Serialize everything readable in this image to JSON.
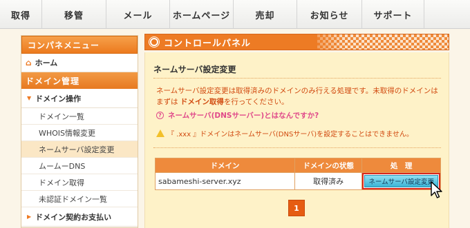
{
  "nav": {
    "items": [
      "取得",
      "移管",
      "メール",
      "ホームページ",
      "売却",
      "お知らせ",
      "サポート"
    ]
  },
  "sidebar": {
    "header": "コンパネメニュー",
    "home": "ホーム",
    "section": "ドメイン管理",
    "group": "ドメイン操作",
    "items": [
      "ドメイン一覧",
      "WHOIS情報変更",
      "ネームサーバ設定変更",
      "ムームーDNS",
      "ドメイン取得",
      "未認証ドメイン一覧"
    ],
    "active_index": 2,
    "group2": "ドメイン契約お支払い"
  },
  "panel": {
    "title": "コントロールパネル"
  },
  "content": {
    "title": "ネームサーバ設定変更",
    "desc_part1": "ネームサーバ設定変更は取得済みのドメインのみ行える処理です。未取得のドメインは",
    "desc_part2": "まずは",
    "desc_link": "ドメイン取得",
    "desc_part3": "を行ってください。",
    "help": "ネームサーバ(DNSサーバー)とはなんですか?",
    "warning": "『 .xxx 』ドメインはネームサーバ(DNSサーバ)を設定することはできません。"
  },
  "table": {
    "headers": [
      "ドメイン",
      "ドメインの状態",
      "処　理"
    ],
    "rows": [
      {
        "domain": "sabameshi-server.xyz",
        "status": "取得済み",
        "action": "ネームサーバ設定変更"
      }
    ]
  },
  "pager": {
    "current": "1"
  },
  "colors": {
    "accent": "#ed7b24",
    "content_bg": "#fef2c8",
    "warning_text": "#d14a10"
  }
}
